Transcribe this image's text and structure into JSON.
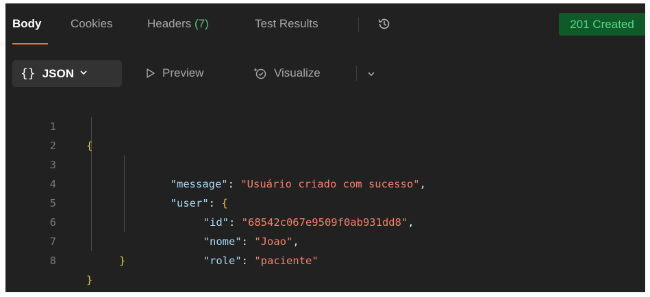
{
  "tabs": [
    {
      "label": "Body",
      "active": true
    },
    {
      "label": "Cookies"
    },
    {
      "label": "Headers",
      "count": "(7)"
    },
    {
      "label": "Test Results"
    }
  ],
  "status": {
    "label": "201 Created",
    "color": "#0f5a29"
  },
  "toolbar": {
    "format_braces": "{}",
    "format_label": "JSON",
    "preview_label": "Preview",
    "visualize_label": "Visualize"
  },
  "code": {
    "line_numbers": [
      "1",
      "2",
      "3",
      "4",
      "5",
      "6",
      "7",
      "8"
    ],
    "lines": {
      "l1": {
        "open": "{"
      },
      "l2": {
        "key": "\"message\"",
        "colon": ": ",
        "value": "\"Usuário criado com sucesso\"",
        "comma": ","
      },
      "l3": {
        "key": "\"user\"",
        "colon": ": ",
        "open": "{"
      },
      "l4": {
        "key": "\"id\"",
        "colon": ": ",
        "value": "\"68542c067e9509f0ab931dd8\"",
        "comma": ","
      },
      "l5": {
        "key": "\"nome\"",
        "colon": ": ",
        "value": "\"Joao\"",
        "comma": ","
      },
      "l6": {
        "key": "\"role\"",
        "colon": ": ",
        "value": "\"paciente\""
      },
      "l7": {
        "close": "}"
      },
      "l8": {
        "close": "}"
      }
    }
  },
  "icons": {
    "history": "history-icon",
    "preview": "play-outline-icon",
    "visualize": "visualize-icon",
    "chevron": "chevron-down-icon"
  }
}
